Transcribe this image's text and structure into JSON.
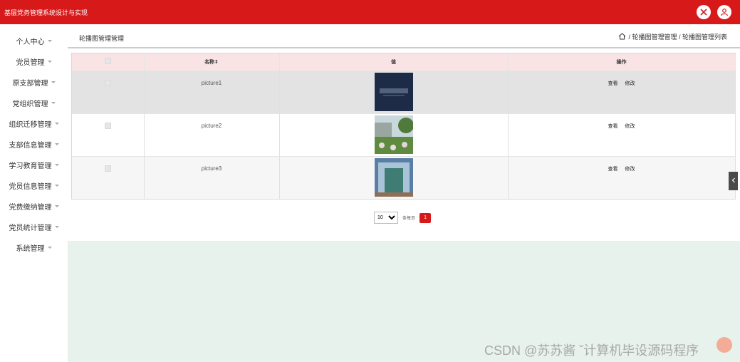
{
  "header": {
    "app_title": "基层党务管理系统设计与实现"
  },
  "sidebar": {
    "items": [
      {
        "label": "个人中心"
      },
      {
        "label": "党员管理"
      },
      {
        "label": "原支部管理"
      },
      {
        "label": "党组织管理"
      },
      {
        "label": "组织迁移管理"
      },
      {
        "label": "支部信息管理"
      },
      {
        "label": "学习教育管理"
      },
      {
        "label": "党员信息管理"
      },
      {
        "label": "党费缴纳管理"
      },
      {
        "label": "党员统计管理"
      },
      {
        "label": "系统管理"
      }
    ]
  },
  "topbar": {
    "page_title": "轮播图管理管理",
    "breadcrumb": "/ 轮播图管理管理 / 轮播图管理列表"
  },
  "table": {
    "headers": {
      "name": "名称⇕",
      "value": "值",
      "ops": "操作"
    },
    "rows": [
      {
        "name": "picture1",
        "view": "查看",
        "edit": "修改"
      },
      {
        "name": "picture2",
        "view": "查看",
        "edit": "修改"
      },
      {
        "name": "picture3",
        "view": "查看",
        "edit": "修改"
      }
    ]
  },
  "pagination": {
    "page_size": "10",
    "page_size_options": [
      "10"
    ],
    "per_page_label": "条每页",
    "current_page": "1"
  },
  "watermark": "CSDN @苏苏酱    ˇ计算机毕设源码程序",
  "colors": {
    "primary": "#d7191a",
    "header_row": "#f9e3e4",
    "footer_bg": "#e8f2ec"
  }
}
